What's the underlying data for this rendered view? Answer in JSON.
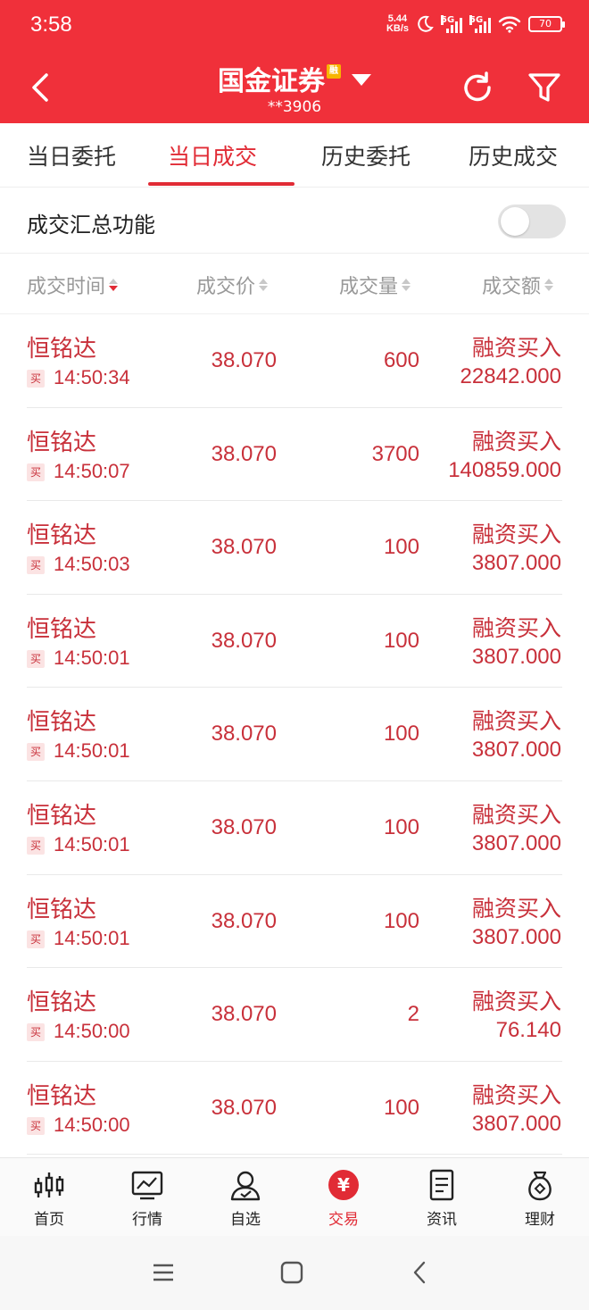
{
  "status_bar": {
    "time": "3:58",
    "net_speed_value": "5.44",
    "net_speed_unit": "KB/s",
    "signal1": "5G",
    "signal2": "5G",
    "battery": "70"
  },
  "header": {
    "title": "国金证券",
    "badge": "融",
    "account": "**3906"
  },
  "tabs": [
    {
      "label": "当日委托"
    },
    {
      "label": "当日成交"
    },
    {
      "label": "历史委托"
    },
    {
      "label": "历史成交"
    }
  ],
  "summary": {
    "label": "成交汇总功能",
    "toggle_on": false
  },
  "columns": {
    "time": "成交时间",
    "price": "成交价",
    "volume": "成交量",
    "amount": "成交额"
  },
  "rows": [
    {
      "name": "恒铭达",
      "side": "买",
      "time": "14:50:34",
      "price": "38.070",
      "qty": "600",
      "action": "融资买入",
      "amount": "22842.000"
    },
    {
      "name": "恒铭达",
      "side": "买",
      "time": "14:50:07",
      "price": "38.070",
      "qty": "3700",
      "action": "融资买入",
      "amount": "140859.000"
    },
    {
      "name": "恒铭达",
      "side": "买",
      "time": "14:50:03",
      "price": "38.070",
      "qty": "100",
      "action": "融资买入",
      "amount": "3807.000"
    },
    {
      "name": "恒铭达",
      "side": "买",
      "time": "14:50:01",
      "price": "38.070",
      "qty": "100",
      "action": "融资买入",
      "amount": "3807.000"
    },
    {
      "name": "恒铭达",
      "side": "买",
      "time": "14:50:01",
      "price": "38.070",
      "qty": "100",
      "action": "融资买入",
      "amount": "3807.000"
    },
    {
      "name": "恒铭达",
      "side": "买",
      "time": "14:50:01",
      "price": "38.070",
      "qty": "100",
      "action": "融资买入",
      "amount": "3807.000"
    },
    {
      "name": "恒铭达",
      "side": "买",
      "time": "14:50:01",
      "price": "38.070",
      "qty": "100",
      "action": "融资买入",
      "amount": "3807.000"
    },
    {
      "name": "恒铭达",
      "side": "买",
      "time": "14:50:00",
      "price": "38.070",
      "qty": "2",
      "action": "融资买入",
      "amount": "76.140"
    },
    {
      "name": "恒铭达",
      "side": "买",
      "time": "14:50:00",
      "price": "38.070",
      "qty": "100",
      "action": "融资买入",
      "amount": "3807.000"
    }
  ],
  "bottom_nav": [
    {
      "label": "首页",
      "icon": "candlestick-icon"
    },
    {
      "label": "行情",
      "icon": "chart-icon"
    },
    {
      "label": "自选",
      "icon": "user-icon"
    },
    {
      "label": "交易",
      "icon": "yuan-icon",
      "glyph": "¥"
    },
    {
      "label": "资讯",
      "icon": "document-icon"
    },
    {
      "label": "理财",
      "icon": "money-bag-icon"
    }
  ],
  "colors": {
    "brand_red": "#f0303a",
    "text_red": "#c8303a",
    "tab_active": "#e12b35"
  }
}
